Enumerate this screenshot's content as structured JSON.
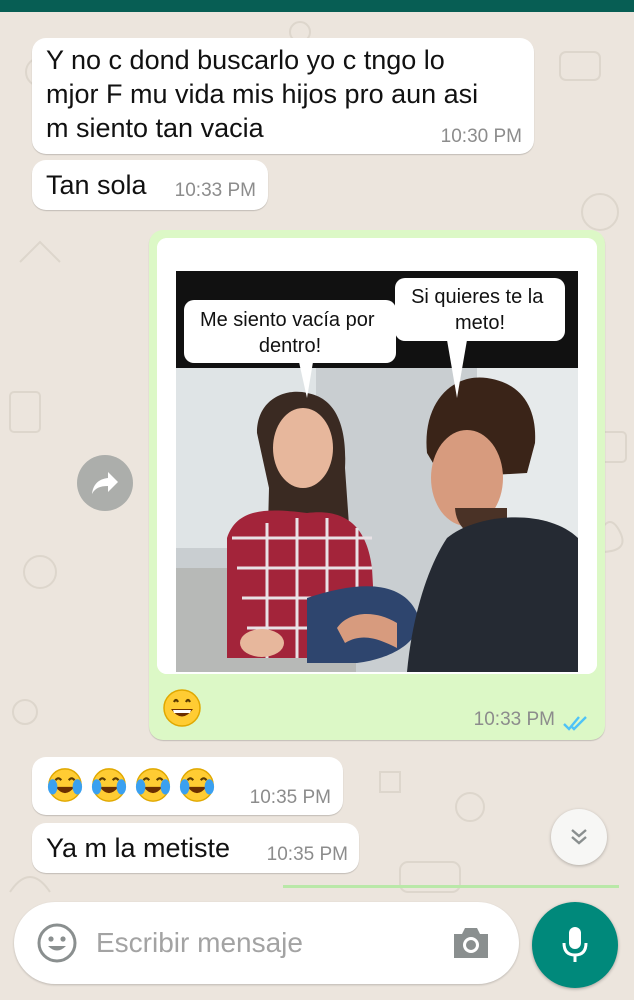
{
  "messages": [
    {
      "direction": "incoming",
      "text": "Y no c dond buscarlo yo c tngo lo\nmjor  F mu vida mis hijos pro  aun asi\nm siento tan vacia",
      "time": "10:30 PM"
    },
    {
      "direction": "incoming",
      "text": "Tan sola",
      "time": "10:33 PM"
    },
    {
      "direction": "outgoing",
      "type": "image",
      "image": {
        "description_icons": [
          "woman",
          "man",
          "speech-bubbles"
        ],
        "caption_left": "Me siento vacía por\ndentro!",
        "caption_right": "Si quieres te la\nmeto!"
      },
      "emoji": [
        "grinning-face"
      ],
      "time": "10:33 PM",
      "status": "read",
      "status_icon": "double-check-icon"
    },
    {
      "direction": "incoming",
      "emoji": [
        "tears-of-joy",
        "tears-of-joy",
        "tears-of-joy",
        "tears-of-joy"
      ],
      "time": "10:35 PM"
    },
    {
      "direction": "incoming",
      "text": "Ya m la metiste",
      "time": "10:35 PM"
    }
  ],
  "composer": {
    "placeholder": "Escribir mensaje"
  },
  "icons": {
    "forward": "forward-icon",
    "scroll_down": "double-chevron-down-icon",
    "emoji": "emoji-icon",
    "camera": "camera-icon",
    "mic": "mic-icon"
  },
  "colors": {
    "header": "#075e54",
    "background": "#ece5dd",
    "incoming_bubble": "#ffffff",
    "outgoing_bubble": "#dcf8c6",
    "read_ticks": "#4fc3f7",
    "mic_button": "#00897b"
  }
}
